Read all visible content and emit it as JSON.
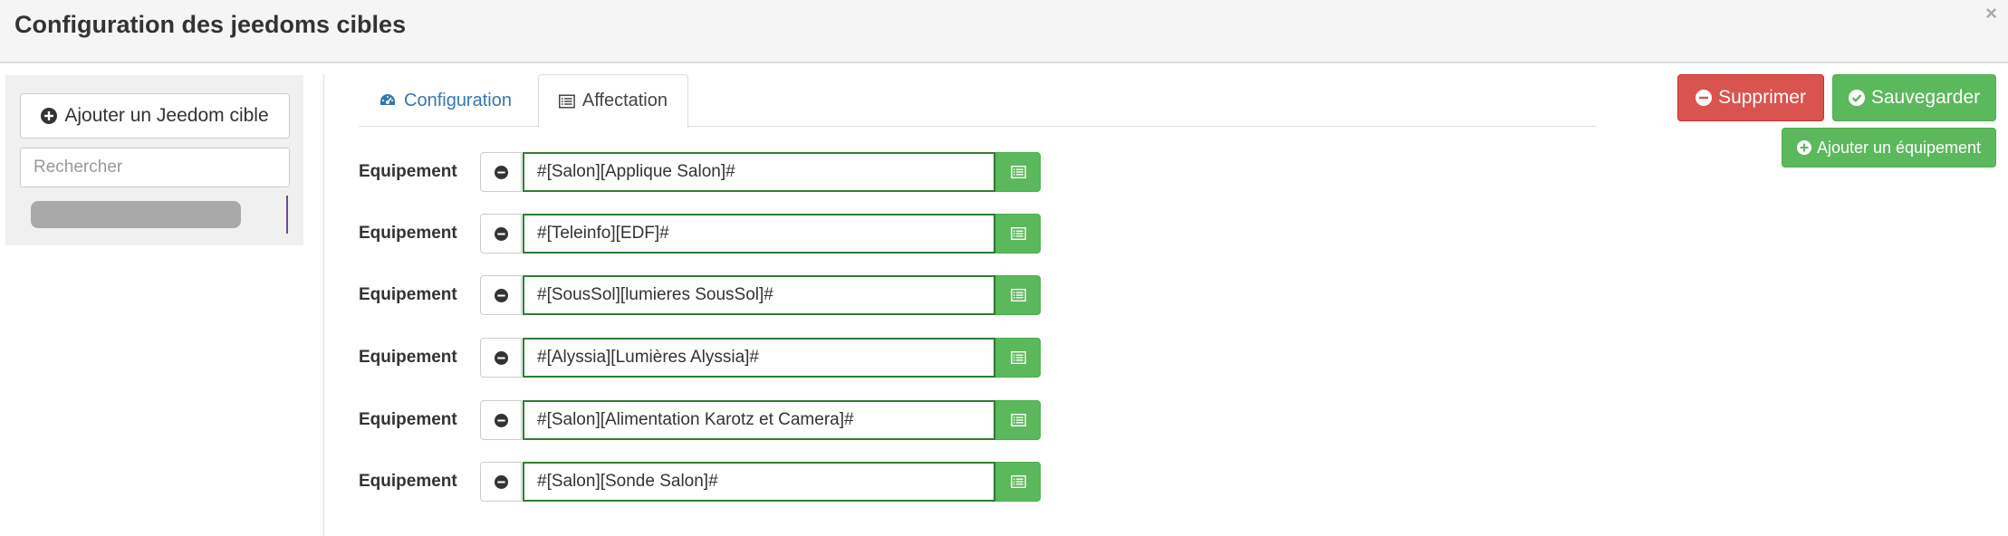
{
  "modal": {
    "title": "Configuration des jeedoms cibles",
    "close_label": "×"
  },
  "sidebar": {
    "add_label": "Ajouter un Jeedom cible",
    "search_placeholder": "Rechercher"
  },
  "tabs": [
    {
      "label": "Configuration",
      "icon": "dashboard-icon",
      "active": false
    },
    {
      "label": "Affectation",
      "icon": "list-alt-icon",
      "active": true
    }
  ],
  "actions": {
    "delete_label": "Supprimer",
    "save_label": "Sauvegarder",
    "add_equipment_label": "Ajouter un équipement"
  },
  "equipments": [
    {
      "label": "Equipement",
      "value": "#[Salon][Applique Salon]#"
    },
    {
      "label": "Equipement",
      "value": "#[Teleinfo][EDF]#"
    },
    {
      "label": "Equipement",
      "value": "#[SousSol][lumieres SousSol]#"
    },
    {
      "label": "Equipement",
      "value": "#[Alyssia][Lumières Alyssia]#"
    },
    {
      "label": "Equipement",
      "value": "#[Salon][Alimentation Karotz et Camera]#"
    },
    {
      "label": "Equipement",
      "value": "#[Salon][Sonde Salon]#"
    }
  ],
  "colors": {
    "danger": "#d9534f",
    "success": "#5cb85c",
    "link": "#3478b0"
  }
}
